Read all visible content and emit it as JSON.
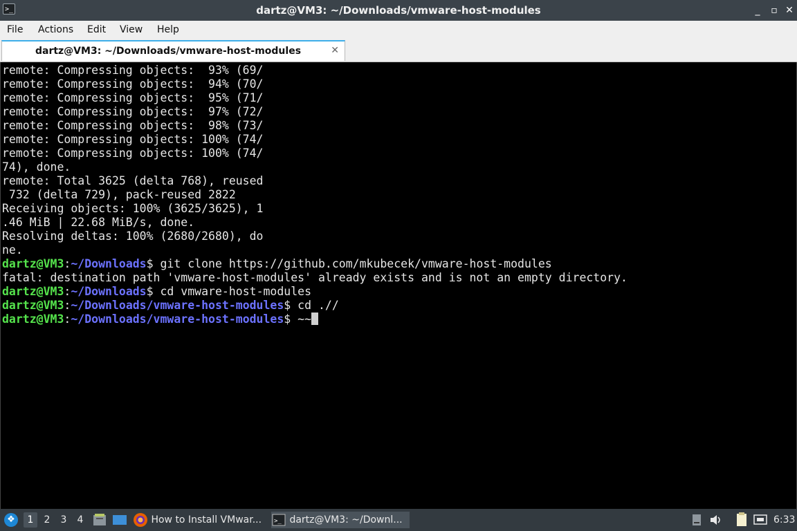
{
  "window": {
    "title": "dartz@VM3: ~/Downloads/vmware-host-modules",
    "app_icon": "terminal-icon",
    "controls": {
      "minimize": "_",
      "maximize": "▫",
      "close": "✕"
    }
  },
  "menubar": {
    "items": [
      "File",
      "Actions",
      "Edit",
      "View",
      "Help"
    ]
  },
  "tab": {
    "label": "dartz@VM3: ~/Downloads/vmware-host-modules",
    "close": "✕"
  },
  "terminal": {
    "output": [
      "remote: Compressing objects:  93% (69/",
      "remote: Compressing objects:  94% (70/",
      "remote: Compressing objects:  95% (71/",
      "remote: Compressing objects:  97% (72/",
      "remote: Compressing objects:  98% (73/",
      "remote: Compressing objects: 100% (74/",
      "remote: Compressing objects: 100% (74/",
      "74), done.",
      "remote: Total 3625 (delta 768), reused",
      " 732 (delta 729), pack-reused 2822",
      "Receiving objects: 100% (3625/3625), 1",
      ".46 MiB | 22.68 MiB/s, done.",
      "Resolving deltas: 100% (2680/2680), do",
      "ne."
    ],
    "commands": [
      {
        "user": "dartz@VM3",
        "sep": ":",
        "path": "~/Downloads",
        "cmd": "$ git clone https://github.com/mkubecek/vmware-host-modules"
      },
      {
        "plain": "fatal: destination path 'vmware-host-modules' already exists and is not an empty directory."
      },
      {
        "user": "dartz@VM3",
        "sep": ":",
        "path": "~/Downloads",
        "cmd": "$ cd vmware-host-modules"
      },
      {
        "user": "dartz@VM3",
        "sep": ":",
        "path": "~/Downloads/vmware-host-modules",
        "cmd": "$ cd .//"
      },
      {
        "user": "dartz@VM3",
        "sep": ":",
        "path": "~/Downloads/vmware-host-modules",
        "cmd": "$ ~~"
      }
    ]
  },
  "taskbar": {
    "start_icon": "start-menu-icon",
    "workspaces": [
      "1",
      "2",
      "3",
      "4"
    ],
    "active_workspace": "1",
    "quick_launch": [
      "file-manager-icon",
      "desktop-icon"
    ],
    "tasks": [
      {
        "icon": "firefox-icon",
        "label": "How to Install VMwar..."
      },
      {
        "icon": "terminal-icon",
        "label": "dartz@VM3: ~/Downl..."
      }
    ],
    "tray": [
      "storage-icon",
      "volume-icon",
      "clipboard-icon",
      "network-icon"
    ],
    "clock": "6:33"
  },
  "colors": {
    "prompt_user": "#55e34c",
    "prompt_path": "#6c72ff",
    "terminal_bg": "#000000",
    "titlebar_bg": "#3b434a",
    "tab_accent": "#3daee9"
  }
}
